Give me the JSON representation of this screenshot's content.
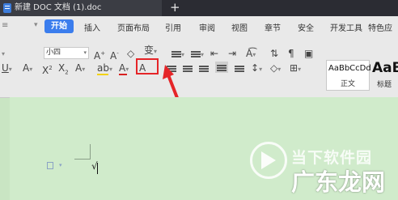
{
  "window": {
    "doc_tab_title": "新建 DOC 文档 (1).doc",
    "new_tab_label": "+"
  },
  "ribbon": {
    "tabs": [
      "开始",
      "插入",
      "页面布局",
      "引用",
      "审阅",
      "视图",
      "章节",
      "安全",
      "开发工具",
      "特色应"
    ],
    "active_tab": "开始",
    "font_size": "小四",
    "highlighted_tool_label": "变",
    "styles": [
      {
        "sample": "AaBbCcDd",
        "name": "正文"
      },
      {
        "sample": "AaB",
        "name": "标题"
      }
    ]
  },
  "colors": {
    "accent": "#3b7ded",
    "highlight_box": "#e52528",
    "page_background": "#d0ebcb"
  },
  "document": {
    "cursor_text": "√"
  },
  "watermark": {
    "line1": "当下软件园",
    "line2": "广东龙网"
  }
}
